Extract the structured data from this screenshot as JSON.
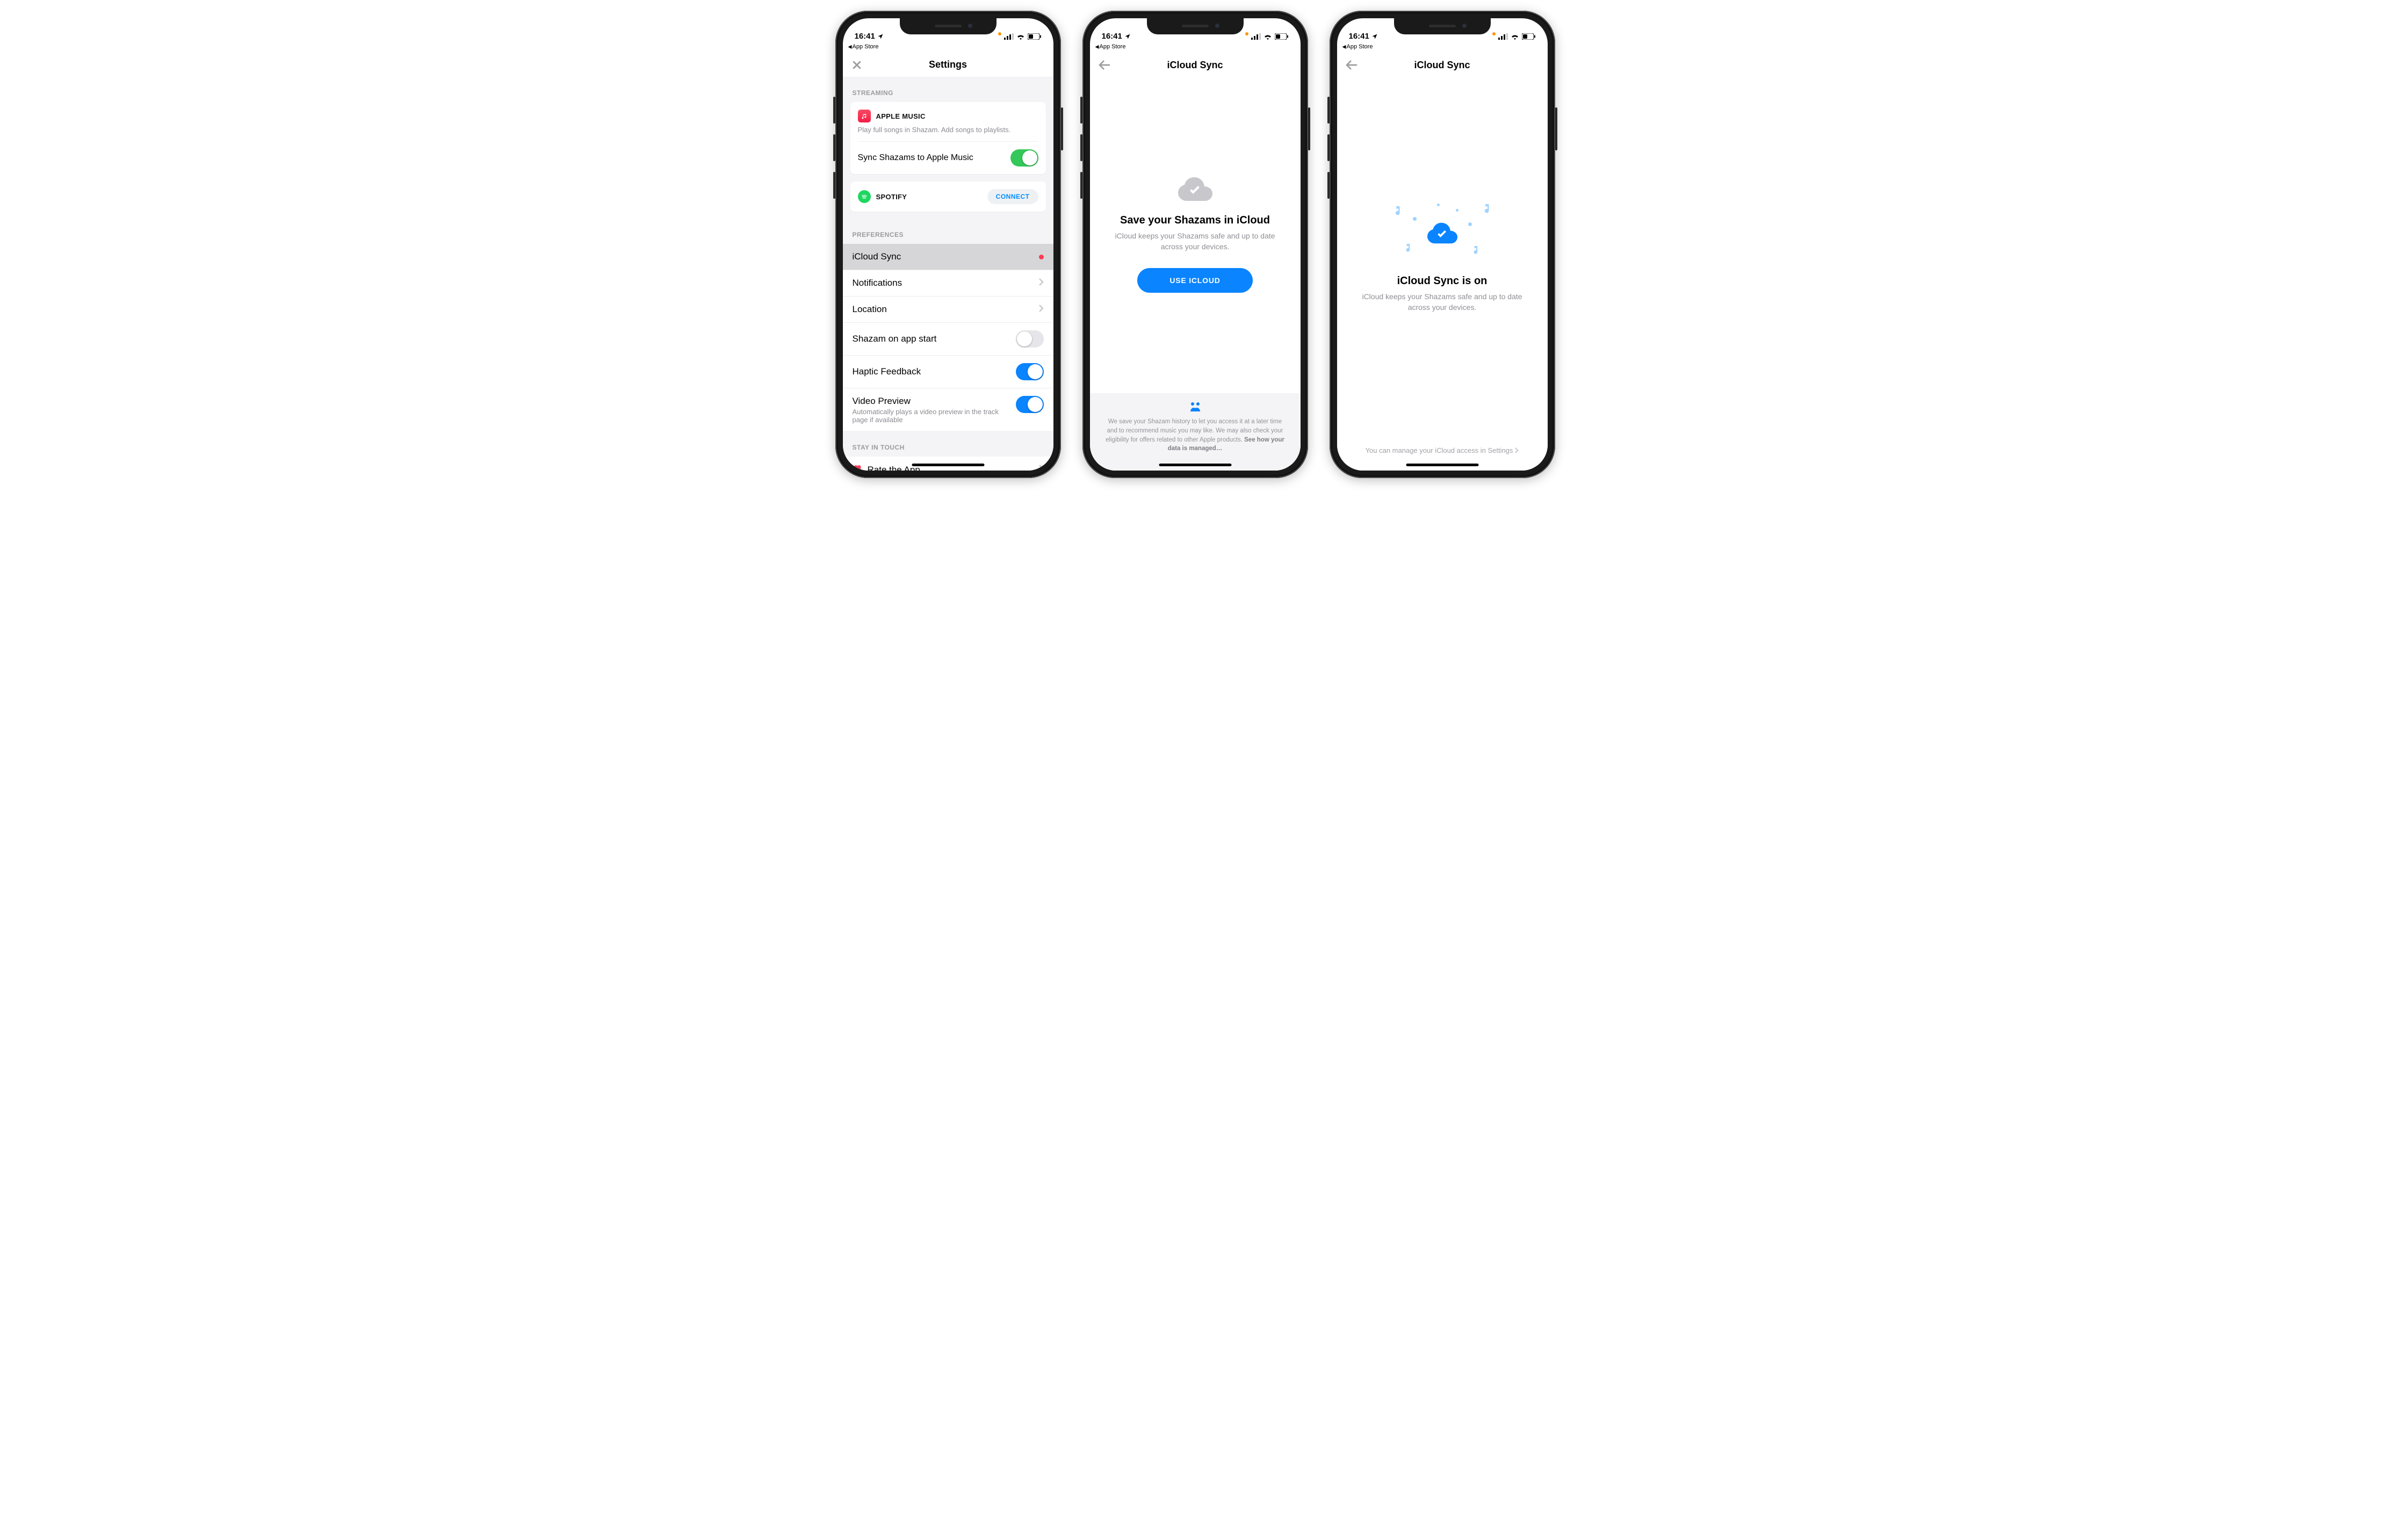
{
  "status": {
    "time": "16:41",
    "breadcrumb": "App Store"
  },
  "screen1": {
    "title": "Settings",
    "streaming": {
      "header": "STREAMING",
      "apple": {
        "brand": "APPLE MUSIC",
        "sub": "Play full songs in Shazam. Add songs to playlists.",
        "sync_label": "Sync Shazams to Apple Music",
        "sync_on": true
      },
      "spotify": {
        "brand": "SPOTIFY",
        "cta": "CONNECT"
      }
    },
    "prefs": {
      "header": "PREFERENCES",
      "items": [
        {
          "label": "iCloud Sync",
          "type": "dot"
        },
        {
          "label": "Notifications",
          "type": "chev"
        },
        {
          "label": "Location",
          "type": "chev"
        },
        {
          "label": "Shazam on app start",
          "type": "switch",
          "on": false
        },
        {
          "label": "Haptic Feedback",
          "type": "switch",
          "on": true
        },
        {
          "label": "Video Preview",
          "type": "switch",
          "on": true,
          "sub": "Automatically plays a video preview in the track page if available"
        }
      ]
    },
    "touch": {
      "header": "STAY IN TOUCH",
      "rate": "Rate the App"
    }
  },
  "screen2": {
    "title": "iCloud Sync",
    "hero_title": "Save your Shazams in iCloud",
    "hero_sub": "iCloud keeps your Shazams safe and up to date across your devices.",
    "cta": "USE ICLOUD",
    "footer_text": "We save your Shazam history to let you access it at a later time and to recommend music you may like. We may also check your eligibility for offers related to other Apple products. ",
    "footer_bold": "See how your data is managed…"
  },
  "screen3": {
    "title": "iCloud Sync",
    "hero_title": "iCloud Sync is on",
    "hero_sub": "iCloud keeps your Shazams safe and up to date across your devices.",
    "footer_link": "You can manage your iCloud access in Settings"
  }
}
